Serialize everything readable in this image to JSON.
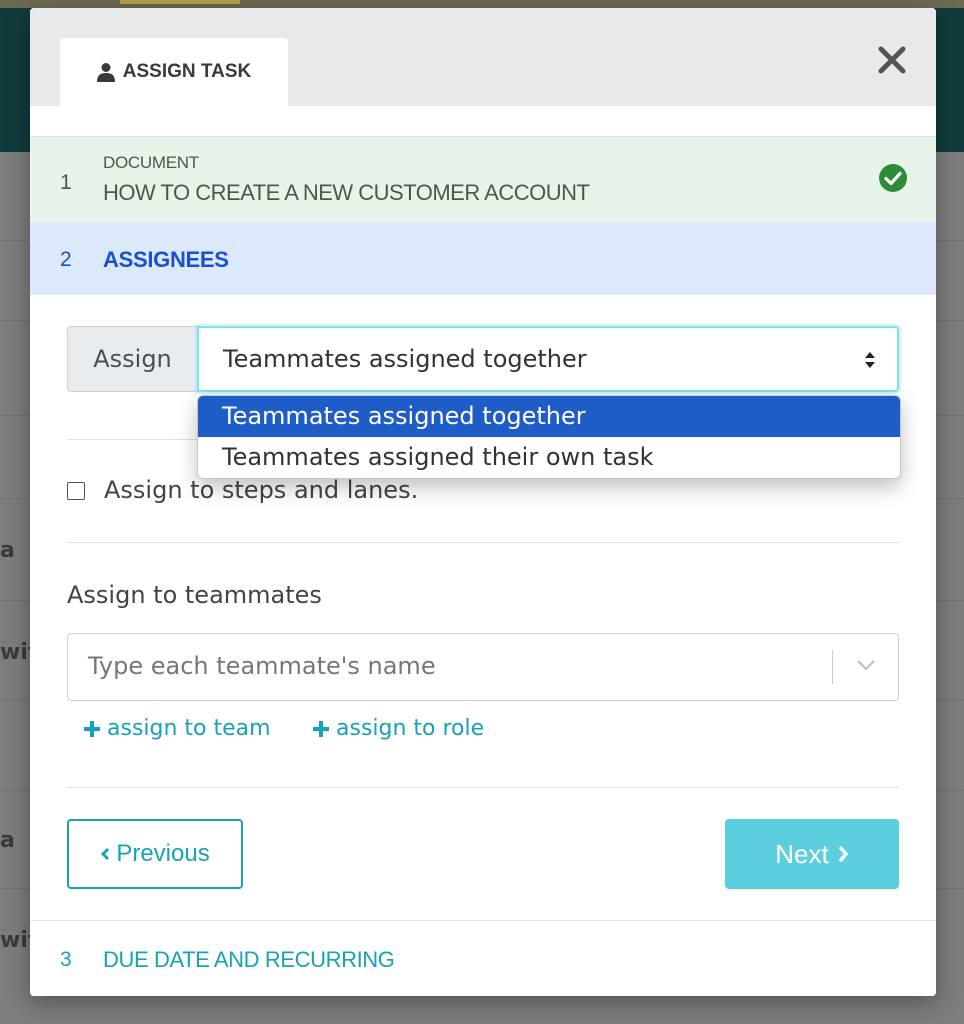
{
  "background": {
    "fragments": [
      "a",
      "wit",
      "a",
      "wit"
    ]
  },
  "modal": {
    "tab_label": "ASSIGN TASK",
    "close_label": "×"
  },
  "steps": [
    {
      "number": "1",
      "category": "DOCUMENT",
      "title": "HOW TO CREATE A NEW CUSTOMER ACCOUNT",
      "status": "complete"
    },
    {
      "number": "2",
      "title": "ASSIGNEES",
      "status": "active"
    },
    {
      "number": "3",
      "title": "DUE DATE AND RECURRING",
      "status": "pending"
    }
  ],
  "assign": {
    "label": "Assign",
    "selected": "Teammates assigned together",
    "options": [
      "Teammates assigned together",
      "Teammates assigned their own task"
    ],
    "highlighted_index": 0
  },
  "steps_lanes": {
    "label": "Assign to steps and lanes.",
    "checked": false
  },
  "teammates": {
    "label": "Assign to teammates",
    "placeholder": "Type each teammate's name"
  },
  "links": {
    "assign_team": "assign to team",
    "assign_role": "assign to role"
  },
  "buttons": {
    "previous": "Previous",
    "next": "Next"
  },
  "colors": {
    "accent": "#17a2b8",
    "step_active": "#1a4fd0",
    "step_complete_bg": "#e8f4e9",
    "check_green": "#2e8b3a",
    "next_button": "#5ccfdf",
    "dropdown_highlight": "#1e5cc8"
  }
}
